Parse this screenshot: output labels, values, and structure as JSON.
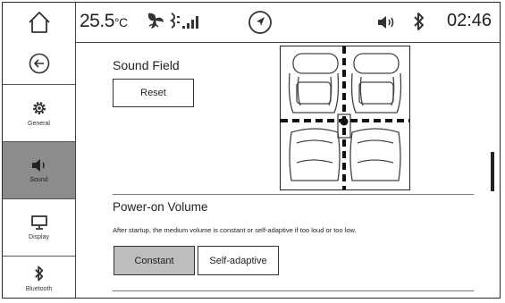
{
  "status_bar": {
    "temperature_value": "25.5",
    "temperature_unit": "°C",
    "time": "02:46",
    "icons": [
      "home-icon",
      "fan-icon",
      "airflow-icon",
      "signal-icon",
      "navigation-icon",
      "volume-icon",
      "bluetooth-icon"
    ]
  },
  "sidebar": {
    "back_icon": "back-arrow-icon",
    "items": [
      {
        "label": "General",
        "icon": "gear-icon",
        "active": false
      },
      {
        "label": "Sound",
        "icon": "speaker-icon",
        "active": true
      },
      {
        "label": "Display",
        "icon": "monitor-icon",
        "active": false
      },
      {
        "label": "Bluetooth",
        "icon": "bluetooth-icon",
        "active": false
      }
    ]
  },
  "sound_field": {
    "title": "Sound Field",
    "reset_label": "Reset"
  },
  "power_on_volume": {
    "title": "Power-on Volume",
    "description": "After startup, the medium volume is constant or self-adaptive if too loud or too low.",
    "options": [
      {
        "label": "Constant",
        "selected": true
      },
      {
        "label": "Self-adaptive",
        "selected": false
      }
    ]
  },
  "colors": {
    "active_sidebar": "#8c8c8c",
    "selected_button": "#bdbdbd"
  }
}
